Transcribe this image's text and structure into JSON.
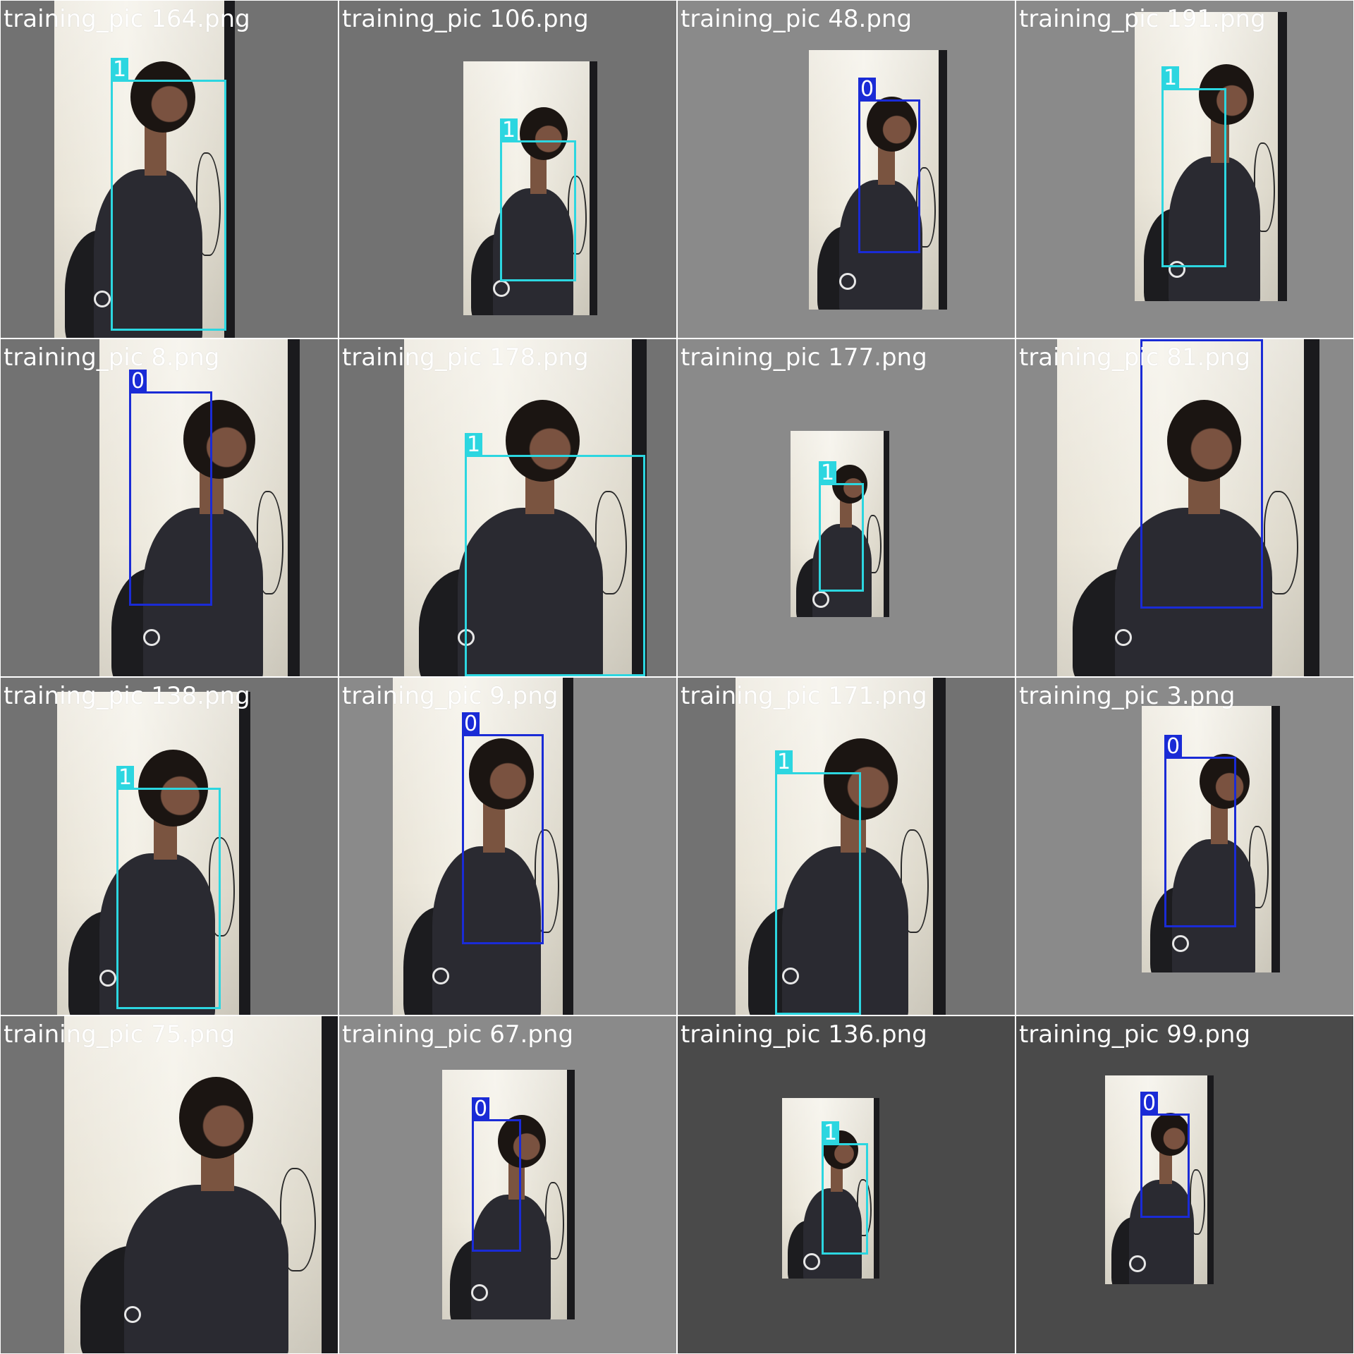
{
  "colors": {
    "class_0": "#1a2bd6",
    "class_1": "#2cd6e0"
  },
  "tiles": [
    {
      "title": "training_pic 164.png",
      "label": "1",
      "bg": "gray"
    },
    {
      "title": "training_pic 106.png",
      "label": "1",
      "bg": "gray"
    },
    {
      "title": "training_pic 48.png",
      "label": "0",
      "bg": "mid"
    },
    {
      "title": "training_pic 191.png",
      "label": "1",
      "bg": "mid"
    },
    {
      "title": "training_pic 8.png",
      "label": "0",
      "bg": "gray"
    },
    {
      "title": "training_pic 178.png",
      "label": "1",
      "bg": "gray"
    },
    {
      "title": "training_pic 177.png",
      "label": "1",
      "bg": "mid"
    },
    {
      "title": "training_pic 81.png",
      "label": "0",
      "bg": "mid"
    },
    {
      "title": "training_pic 138.png",
      "label": "1",
      "bg": "gray"
    },
    {
      "title": "training_pic 9.png",
      "label": "0",
      "bg": "mid"
    },
    {
      "title": "training_pic 171.png",
      "label": "1",
      "bg": "gray"
    },
    {
      "title": "training_pic 3.png",
      "label": "0",
      "bg": "mid"
    },
    {
      "title": "training_pic 75.png",
      "label": "",
      "bg": "gray"
    },
    {
      "title": "training_pic 67.png",
      "label": "0",
      "bg": "mid"
    },
    {
      "title": "training_pic 136.png",
      "label": "1",
      "bg": "dark"
    },
    {
      "title": "training_pic 99.png",
      "label": "0",
      "bg": "dark"
    }
  ]
}
